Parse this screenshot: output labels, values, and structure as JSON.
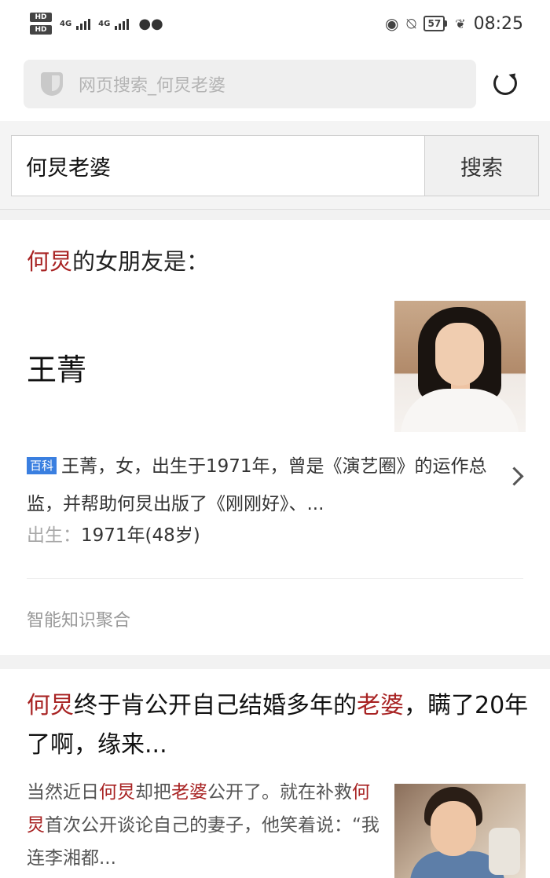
{
  "status_bar": {
    "hd1": "HD",
    "hd2": "HD",
    "net1": "4G",
    "net2": "4G",
    "battery": "57",
    "time": "08:25"
  },
  "browser": {
    "address": "网页搜索_何炅老婆"
  },
  "search": {
    "query": "何炅老婆",
    "button_label": "搜索"
  },
  "answer_card": {
    "title_highlight": "何炅",
    "title_rest": "的女朋友是：",
    "answer_name": "王菁",
    "badge": "百科",
    "description": "王菁，女，出生于1971年，曾是《演艺圈》的运作总监，并帮助何炅出版了《刚刚好》、...",
    "birth_label": "出生：",
    "birth_value": "1971年(48岁)",
    "aggregator_label": "智能知识聚合"
  },
  "result_card": {
    "title_parts": [
      {
        "text": "何炅",
        "hl": true
      },
      {
        "text": "终于肯公开自己结婚多年的",
        "hl": false
      },
      {
        "text": "老婆",
        "hl": true
      },
      {
        "text": "，瞒了20年了啊，缘来...",
        "hl": false
      }
    ],
    "snippet_parts": [
      {
        "text": "当然近日",
        "hl": false
      },
      {
        "text": "何炅",
        "hl": true
      },
      {
        "text": "却把",
        "hl": false
      },
      {
        "text": "老婆",
        "hl": true
      },
      {
        "text": "公开了。就在补救",
        "hl": false
      },
      {
        "text": "何炅",
        "hl": true
      },
      {
        "text": "首次公开谈论自己的妻子，他笑着说：“我连李湘都...",
        "hl": false
      }
    ]
  },
  "colors": {
    "highlight": "#a82323",
    "badge": "#3a7fe0"
  }
}
